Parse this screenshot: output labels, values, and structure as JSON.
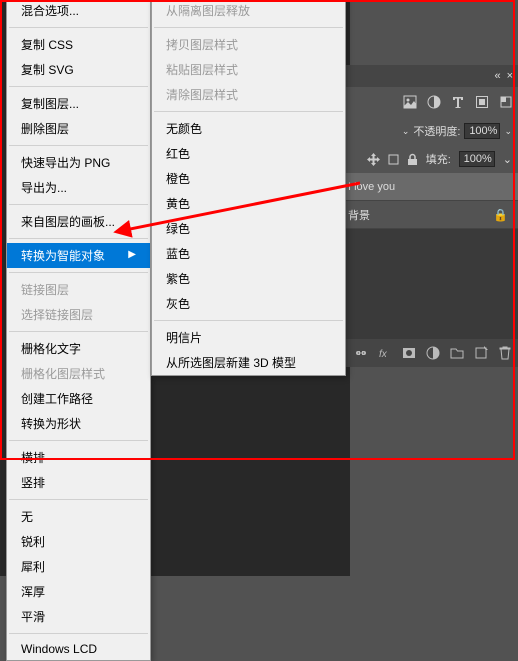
{
  "panel_header": {
    "collapse": "«",
    "close": "×"
  },
  "opacity": {
    "label": "不透明度:",
    "value": "100%"
  },
  "fill": {
    "label": "填充:",
    "value": "100%"
  },
  "layers": [
    {
      "name": "I love you",
      "active": true,
      "locked": false
    },
    {
      "name": "背景",
      "active": false,
      "locked": true
    }
  ],
  "menu_left": {
    "groups": [
      [
        {
          "label": "混合选项...",
          "enabled": true
        }
      ],
      [
        {
          "label": "复制 CSS",
          "enabled": true
        },
        {
          "label": "复制 SVG",
          "enabled": true
        }
      ],
      [
        {
          "label": "复制图层...",
          "enabled": true
        },
        {
          "label": "删除图层",
          "enabled": true
        }
      ],
      [
        {
          "label": "快速导出为 PNG",
          "enabled": true
        },
        {
          "label": "导出为...",
          "enabled": true
        }
      ],
      [
        {
          "label": "来自图层的画板...",
          "enabled": true
        }
      ],
      [
        {
          "label": "转换为智能对象",
          "enabled": true,
          "highlighted": true,
          "submenu": true
        }
      ],
      [
        {
          "label": "链接图层",
          "enabled": false
        },
        {
          "label": "选择链接图层",
          "enabled": false
        }
      ],
      [
        {
          "label": "栅格化文字",
          "enabled": true
        },
        {
          "label": "栅格化图层样式",
          "enabled": false
        },
        {
          "label": "创建工作路径",
          "enabled": true
        },
        {
          "label": "转换为形状",
          "enabled": true
        }
      ],
      [
        {
          "label": "横排",
          "enabled": true
        },
        {
          "label": "竖排",
          "enabled": true
        }
      ],
      [
        {
          "label": "无",
          "enabled": true
        },
        {
          "label": "锐利",
          "enabled": true
        },
        {
          "label": "犀利",
          "enabled": true
        },
        {
          "label": "浑厚",
          "enabled": true
        },
        {
          "label": "平滑",
          "enabled": true
        }
      ],
      [
        {
          "label": "Windows LCD",
          "enabled": true
        }
      ]
    ]
  },
  "menu_right": {
    "groups": [
      [
        {
          "label": "从隔离图层释放",
          "enabled": false
        }
      ],
      [
        {
          "label": "拷贝图层样式",
          "enabled": false
        },
        {
          "label": "粘贴图层样式",
          "enabled": false
        },
        {
          "label": "清除图层样式",
          "enabled": false
        }
      ],
      [
        {
          "label": "无颜色",
          "enabled": true
        },
        {
          "label": "红色",
          "enabled": true
        },
        {
          "label": "橙色",
          "enabled": true
        },
        {
          "label": "黄色",
          "enabled": true
        },
        {
          "label": "绿色",
          "enabled": true
        },
        {
          "label": "蓝色",
          "enabled": true
        },
        {
          "label": "紫色",
          "enabled": true
        },
        {
          "label": "灰色",
          "enabled": true
        }
      ],
      [
        {
          "label": "明信片",
          "enabled": true
        },
        {
          "label": "从所选图层新建 3D 模型",
          "enabled": true
        }
      ]
    ]
  }
}
